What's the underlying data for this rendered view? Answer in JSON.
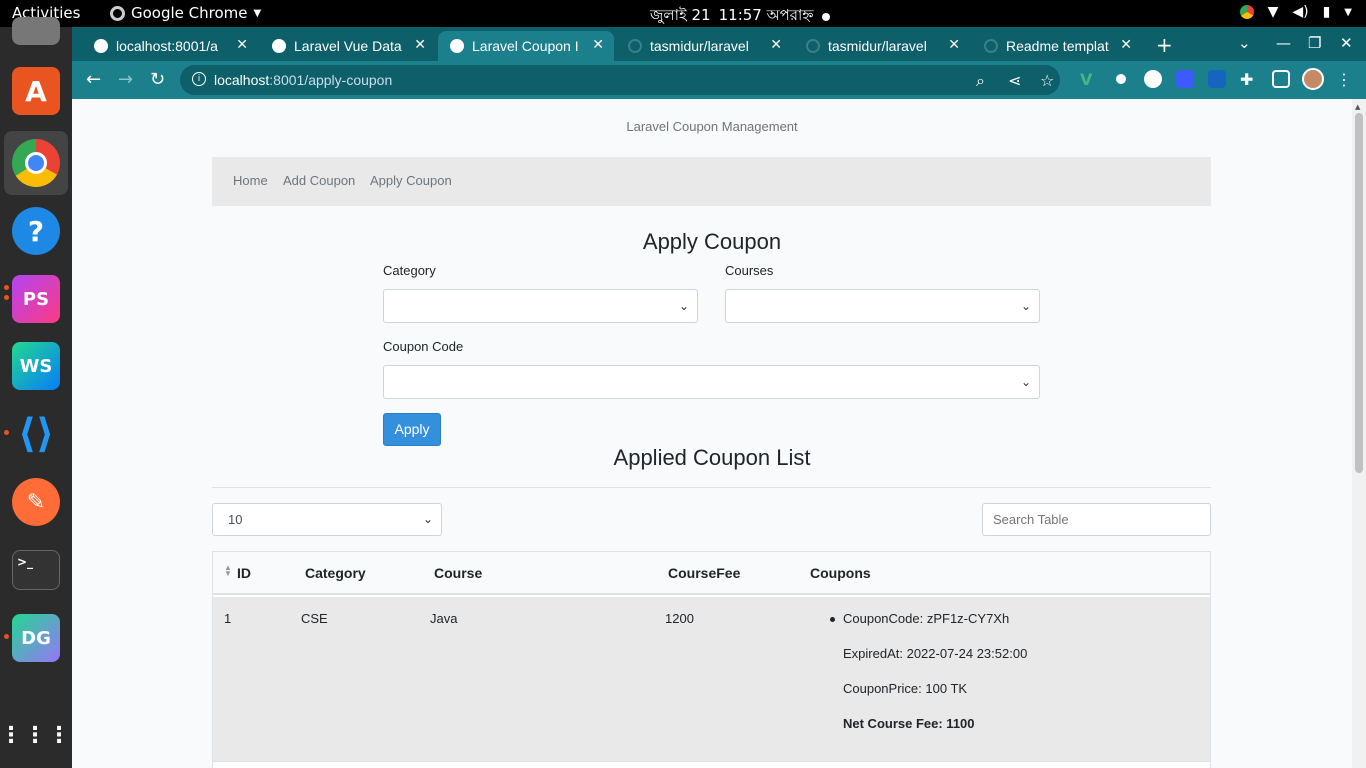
{
  "os": {
    "activities": "Activities",
    "app_name": "Google Chrome",
    "clock_date": "জুলাই 21",
    "clock_time": "11:57 অপরাহ্ন"
  },
  "browser": {
    "tabs": [
      {
        "title": "localhost:8001/a",
        "active": false
      },
      {
        "title": "Laravel Vue Data",
        "active": false
      },
      {
        "title": "Laravel Coupon I",
        "active": true
      },
      {
        "title": "tasmidur/laravel",
        "active": false
      },
      {
        "title": "tasmidur/laravel",
        "active": false
      },
      {
        "title": "Readme templat",
        "active": false
      }
    ],
    "url_host": "localhost",
    "url_path": ":8001/apply-coupon",
    "colors": {
      "tabstrip": "#0d5f6a",
      "toolbar": "#1b7f8c"
    }
  },
  "page": {
    "brand": "Laravel Coupon Management",
    "nav": [
      "Home",
      "Add Coupon",
      "Apply Coupon"
    ],
    "form": {
      "title": "Apply Coupon",
      "category_label": "Category",
      "courses_label": "Courses",
      "coupon_code_label": "Coupon Code",
      "apply_label": "Apply"
    },
    "list": {
      "title": "Applied Coupon List",
      "per_page": "10",
      "search_placeholder": "Search Table",
      "columns": [
        "ID",
        "Category",
        "Course",
        "CourseFee",
        "Coupons"
      ],
      "rows": [
        {
          "id": "1",
          "category": "CSE",
          "course": "Java",
          "course_fee": "1200",
          "coupon_code": "CouponCode: zPF1z-CY7Xh",
          "expired_at": "ExpiredAt: 2022-07-24 23:52:00",
          "coupon_price": "CouponPrice: 100 TK",
          "net_fee": "Net Course Fee: 1100"
        }
      ]
    },
    "colors": {
      "primary_button": "#3490dc",
      "nav_bg": "#e9e9e9"
    }
  }
}
